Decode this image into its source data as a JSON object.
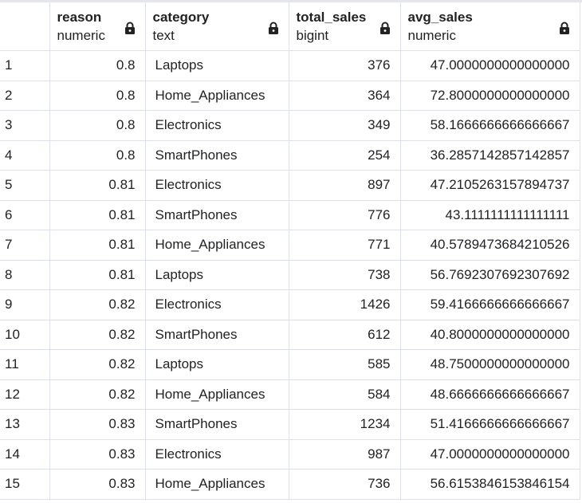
{
  "columns": [
    {
      "name": "reason",
      "type": "numeric"
    },
    {
      "name": "category",
      "type": "text"
    },
    {
      "name": "total_sales",
      "type": "bigint"
    },
    {
      "name": "avg_sales",
      "type": "numeric"
    }
  ],
  "rows": [
    [
      "1",
      "0.8",
      "Laptops",
      "376",
      "47.0000000000000000"
    ],
    [
      "2",
      "0.8",
      "Home_Appliances",
      "364",
      "72.8000000000000000"
    ],
    [
      "3",
      "0.8",
      "Electronics",
      "349",
      "58.1666666666666667"
    ],
    [
      "4",
      "0.8",
      "SmartPhones",
      "254",
      "36.2857142857142857"
    ],
    [
      "5",
      "0.81",
      "Electronics",
      "897",
      "47.2105263157894737"
    ],
    [
      "6",
      "0.81",
      "SmartPhones",
      "776",
      "43.1111111111111111"
    ],
    [
      "7",
      "0.81",
      "Home_Appliances",
      "771",
      "40.5789473684210526"
    ],
    [
      "8",
      "0.81",
      "Laptops",
      "738",
      "56.7692307692307692"
    ],
    [
      "9",
      "0.82",
      "Electronics",
      "1426",
      "59.4166666666666667"
    ],
    [
      "10",
      "0.82",
      "SmartPhones",
      "612",
      "40.8000000000000000"
    ],
    [
      "11",
      "0.82",
      "Laptops",
      "585",
      "48.7500000000000000"
    ],
    [
      "12",
      "0.82",
      "Home_Appliances",
      "584",
      "48.6666666666666667"
    ],
    [
      "13",
      "0.83",
      "SmartPhones",
      "1234",
      "51.4166666666666667"
    ],
    [
      "14",
      "0.83",
      "Electronics",
      "987",
      "47.0000000000000000"
    ],
    [
      "15",
      "0.83",
      "Home_Appliances",
      "736",
      "56.6153846153846154"
    ]
  ]
}
